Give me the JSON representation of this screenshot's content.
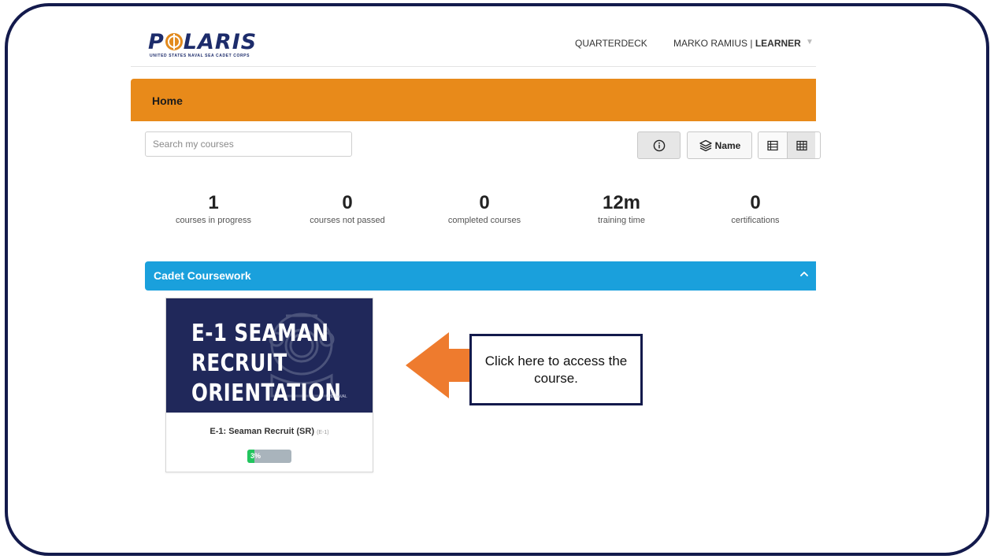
{
  "app": {
    "logo_text_1": "P",
    "logo_text_2": "LARIS",
    "logo_subtitle": "UNITED STATES NAVAL SEA CADET CORPS"
  },
  "header": {
    "nav_link": "QUARTERDECK",
    "user_name": "MARKO RAMIUS |",
    "user_role": "LEARNER",
    "caret_icon": "chevron-down-icon"
  },
  "home": {
    "title": "Home"
  },
  "toolbar": {
    "search_placeholder": "Search my courses",
    "info_icon": "info-icon",
    "sort_label": "Name",
    "sort_icon": "layers-icon",
    "list_view_icon": "list-view-icon",
    "grid_view_icon": "grid-view-icon"
  },
  "stats": [
    {
      "value": "1",
      "label": "courses in progress"
    },
    {
      "value": "0",
      "label": "courses not passed"
    },
    {
      "value": "0",
      "label": "completed courses"
    },
    {
      "value": "12m",
      "label": "training time"
    },
    {
      "value": "0",
      "label": "certifications"
    }
  ],
  "section": {
    "title": "Cadet Coursework",
    "collapse_icon": "chevron-up-icon"
  },
  "course": {
    "thumb_line_1": "E-1 SEAMAN",
    "thumb_line_2": "RECRUIT",
    "thumb_line_3": "ORIENTATION",
    "thumb_watermark": "U.S. NAVAL",
    "name": "E-1: Seaman Recruit (SR)",
    "code": "(E-1)",
    "progress_label": "3%",
    "progress_fraction": 0.03
  },
  "callout": {
    "text": "Click here to access the course."
  },
  "colors": {
    "frame": "#131a4c",
    "home_bar": "#e88a1a",
    "section_bar": "#1aa0dc",
    "arrow": "#ee7b2e",
    "progress_fill": "#22c55e",
    "thumb_bg": "#20285a"
  }
}
